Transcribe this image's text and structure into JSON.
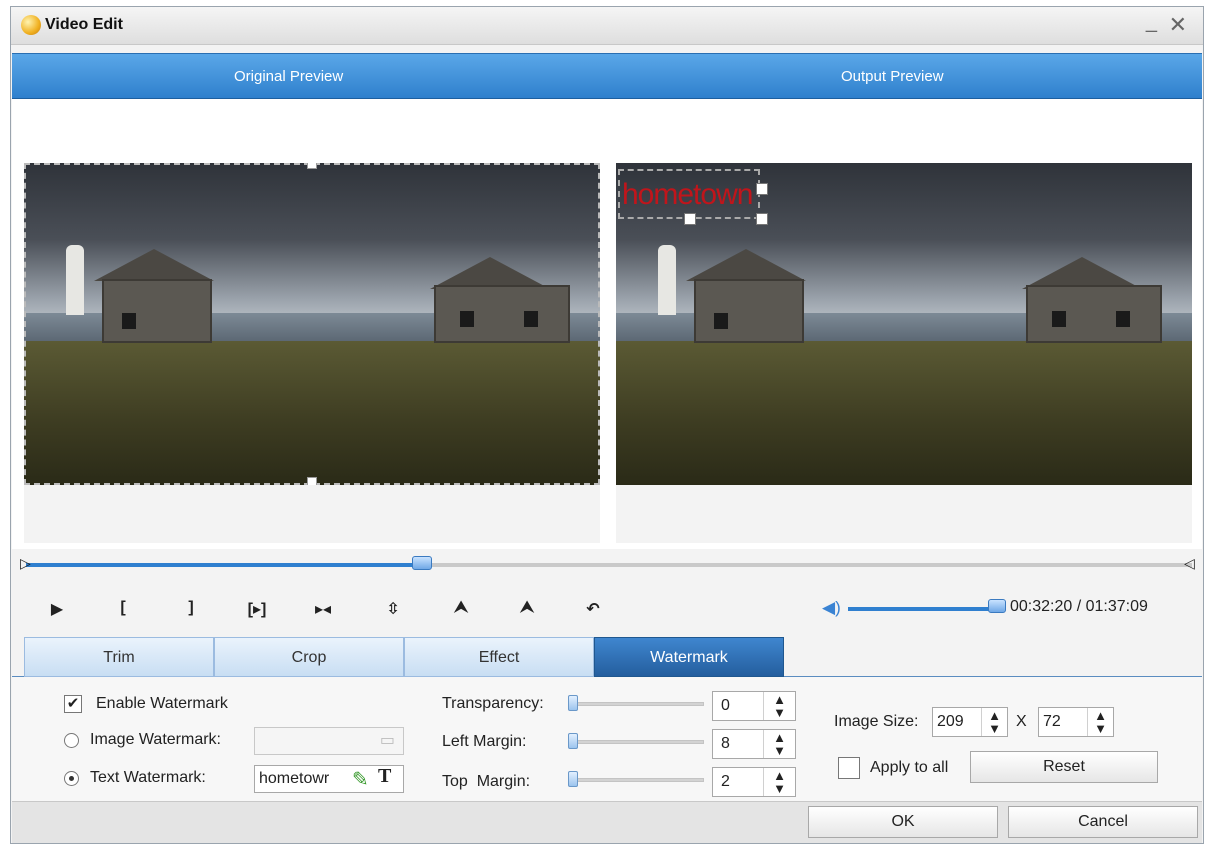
{
  "window": {
    "title": "Video Edit",
    "minimize_label": "_",
    "close_label": "✕"
  },
  "preview": {
    "original_label": "Original Preview",
    "output_label": "Output Preview",
    "watermark_text": "hometown"
  },
  "controls": {
    "buttons": [
      {
        "name": "play-button",
        "icon": "play-icon",
        "glyph": "▶"
      },
      {
        "name": "set-start-button",
        "icon": "bracket-open-icon",
        "glyph": "["
      },
      {
        "name": "set-end-button",
        "icon": "bracket-close-icon",
        "glyph": "]"
      },
      {
        "name": "play-segment-button",
        "icon": "play-segment-icon",
        "glyph": "[▸]"
      },
      {
        "name": "step-button",
        "icon": "step-icon",
        "glyph": "▸◂"
      },
      {
        "name": "flip-vertical-button",
        "icon": "flip-vertical-icon",
        "glyph": "⇳"
      },
      {
        "name": "rotate-left-button",
        "icon": "rotate-left-icon",
        "glyph": "⮝"
      },
      {
        "name": "rotate-right-button",
        "icon": "rotate-right-icon",
        "glyph": "⮝"
      },
      {
        "name": "undo-button",
        "icon": "undo-icon",
        "glyph": "↶"
      }
    ],
    "progress_fraction": 0.34,
    "volume_fraction": 0.93,
    "time_current": "00:32:20",
    "time_separator": " / ",
    "time_total": "01:37:09"
  },
  "tabs": [
    {
      "label": "Trim",
      "active": false
    },
    {
      "label": "Crop",
      "active": false
    },
    {
      "label": "Effect",
      "active": false
    },
    {
      "label": "Watermark",
      "active": true
    }
  ],
  "watermark": {
    "enable_label": "Enable Watermark",
    "enable_checked": true,
    "image_label": "Image Watermark:",
    "text_label": "Text Watermark:",
    "text_value": "hometowr",
    "transparency_label": "Transparency:",
    "transparency_value": "0",
    "left_margin_label": "Left Margin:",
    "left_margin_value": "8",
    "top_margin_label": "Top  Margin:",
    "top_margin_value": "2",
    "image_size_label": "Image Size:",
    "width_value": "209",
    "x_label": "X",
    "height_value": "72",
    "apply_all_label": "Apply to all",
    "reset_label": "Reset"
  },
  "footer": {
    "ok_label": "OK",
    "cancel_label": "Cancel"
  }
}
